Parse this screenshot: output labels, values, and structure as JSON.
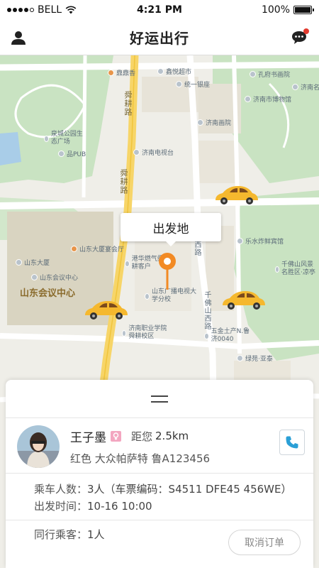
{
  "status_bar": {
    "carrier": "BELL",
    "time": "4:21 PM",
    "battery": "100%",
    "battery_level": 1.0,
    "signal_bars": 4,
    "signal_total": 5
  },
  "header": {
    "title": "好运出行",
    "user_icon": "user-icon",
    "message_icon": "chat-bubble-icon",
    "has_unread": true
  },
  "map": {
    "pickup_label": "出发地",
    "pois": [
      "鼎鼎香",
      "鑫悦超市",
      "孔府书画院",
      "统一银座",
      "济南市博物馆",
      "济南名泉",
      "泉城公园生态广场",
      "济南画院",
      "品PUB",
      "济南电视台",
      "山东大厦宴会厅",
      "乐水炸鲜宾馆",
      "山东大厦",
      "港华燃气舜耕客户",
      "千佛山风景名胜区·凉亭",
      "山东会议中心",
      "山东广播电视大学分校",
      "济南职业学院舜耕校区",
      "五金土产N.鲁济0040",
      "绿苑·亚泰"
    ],
    "big_label": "山东会议中心",
    "roads": [
      "舜耕路",
      "舜耕路",
      "山西路",
      "千佛山西路"
    ]
  },
  "driver": {
    "name": "王子墨",
    "distance_label": "距您",
    "distance": "2.5km",
    "car": "红色 大众帕萨特 鲁A123456"
  },
  "trip": {
    "passengers_label": "乘车人数：",
    "passengers_value": "3人（车票编码：S4511 DFE45 456WE）",
    "depart_label": "出发时间：",
    "depart_value": "10-16 10:00",
    "companions_label": "同行乘客：",
    "companions_value": "1人"
  },
  "actions": {
    "cancel": "取消订单"
  },
  "colors": {
    "accent": "#f39c12",
    "car_yellow": "#f5b82e",
    "pin_orange": "#f28a24"
  }
}
